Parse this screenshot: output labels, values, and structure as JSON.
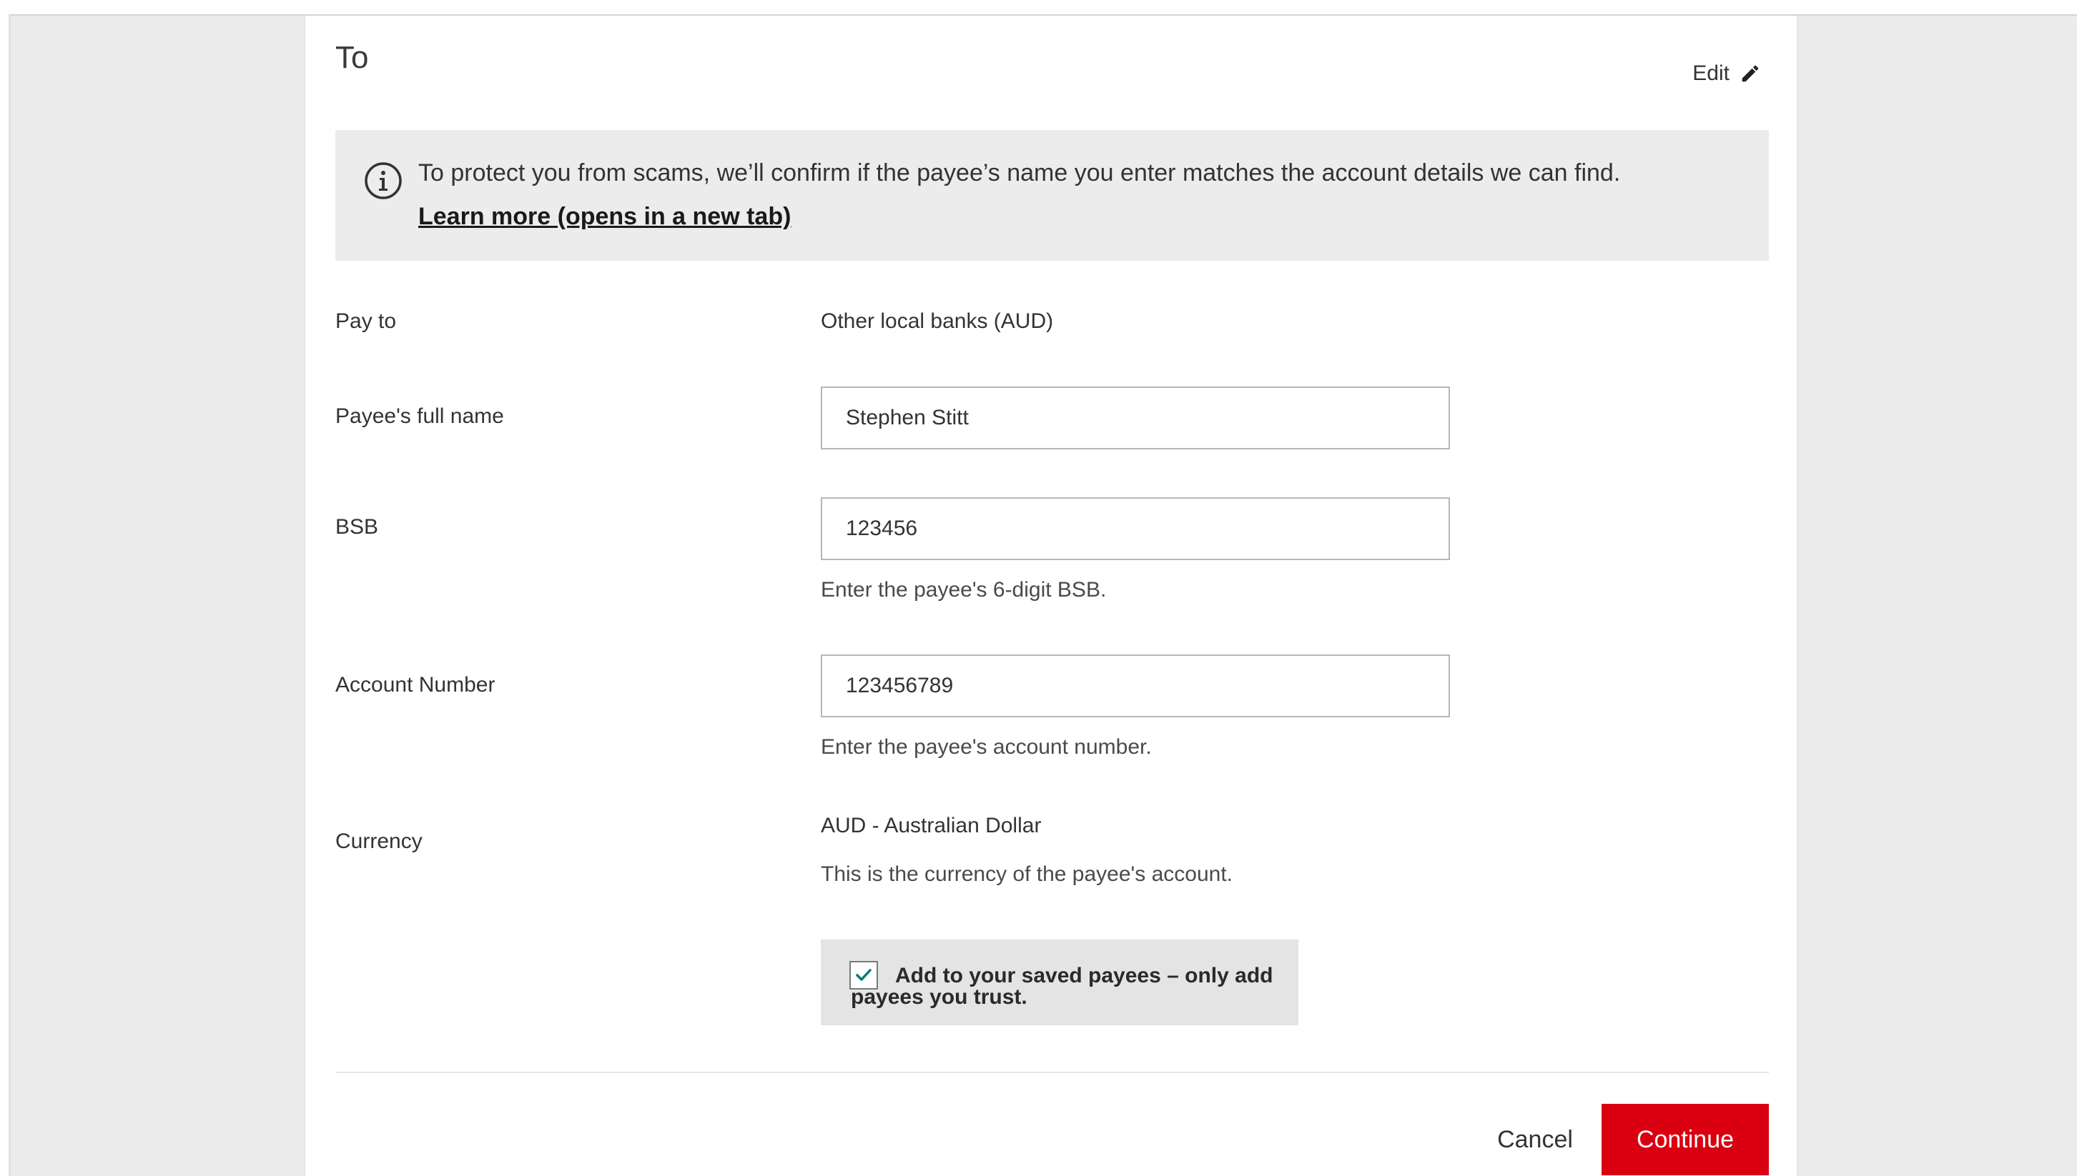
{
  "section": {
    "title": "To",
    "edit_label": "Edit"
  },
  "info_banner": {
    "icon": "info-icon",
    "text": "To protect you from scams, we’ll confirm if the payee’s name you enter matches the account details we can find.",
    "link_text": "Learn more (opens in a new tab)"
  },
  "form": {
    "pay_to": {
      "label": "Pay to",
      "value": "Other local banks (AUD)"
    },
    "payee_name": {
      "label": "Payee's full name",
      "value": "Stephen Stitt"
    },
    "bsb": {
      "label": "BSB",
      "value": "123456",
      "hint": "Enter the payee's 6-digit BSB."
    },
    "account_number": {
      "label": "Account Number",
      "value": "123456789",
      "hint": "Enter the payee's account number."
    },
    "currency": {
      "label": "Currency",
      "value": "AUD - Australian Dollar",
      "hint": "This is the currency of the payee's account."
    },
    "save_payee": {
      "label": "Add to your saved payees – only add payees you trust.",
      "checked": true
    }
  },
  "actions": {
    "cancel_label": "Cancel",
    "continue_label": "Continue"
  },
  "colors": {
    "primary": "#db0011",
    "check": "#007b7b",
    "banner_bg": "#ececec",
    "page_bg": "#ebebeb"
  }
}
